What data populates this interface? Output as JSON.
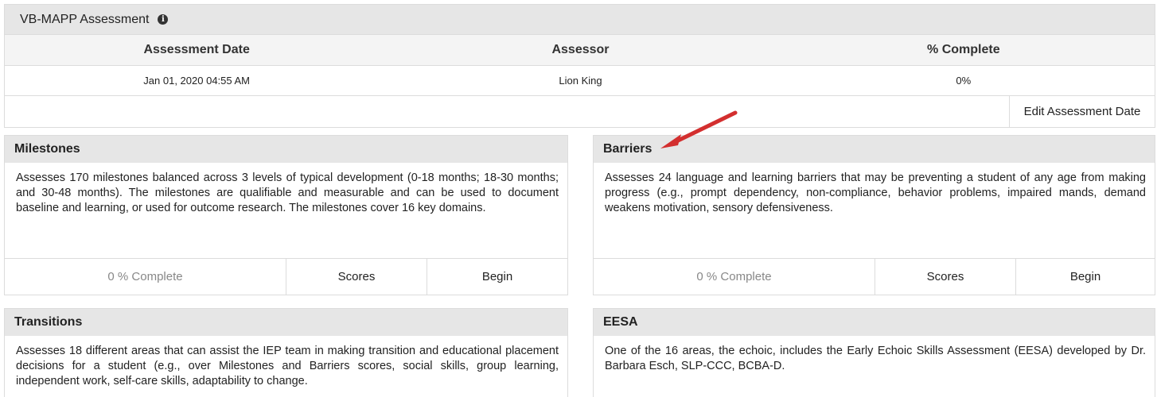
{
  "assessment": {
    "title": "VB-MAPP Assessment",
    "info_icon": "info-circle",
    "columns": [
      "Assessment Date",
      "Assessor",
      "% Complete"
    ],
    "row": {
      "date": "Jan 01, 2020 04:55 AM",
      "assessor": "Lion King",
      "complete": "0%"
    },
    "edit_label": "Edit Assessment Date"
  },
  "cards": {
    "milestones": {
      "title": "Milestones",
      "description": "Assesses 170 milestones balanced across 3 levels of typical development (0-18 months; 18-30 months; and 30-48 months). The milestones are qualifiable and measurable and can be used to document baseline and learning, or used for outcome research. The milestones cover 16 key domains.",
      "status": "0 % Complete",
      "scores_label": "Scores",
      "begin_label": "Begin"
    },
    "barriers": {
      "title": "Barriers",
      "description": "Assesses 24 language and learning barriers that may be preventing a student of any age from making progress (e.g., prompt dependency, non-compliance, behavior problems, impaired mands, demand weakens motivation, sensory defensiveness.",
      "status": "0 % Complete",
      "scores_label": "Scores",
      "begin_label": "Begin"
    },
    "transitions": {
      "title": "Transitions",
      "description": "Assesses 18 different areas that can assist the IEP team in making transition and educational placement decisions for a student (e.g., over Milestones and Barriers scores, social skills, group learning, independent work, self-care skills, adaptability to change."
    },
    "eesa": {
      "title": "EESA",
      "description": "One of the 16 areas, the echoic, includes the Early Echoic Skills Assessment (EESA) developed by Dr. Barbara Esch, SLP-CCC, BCBA-D."
    }
  },
  "annotation": {
    "arrow_color": "#d32f2f"
  }
}
